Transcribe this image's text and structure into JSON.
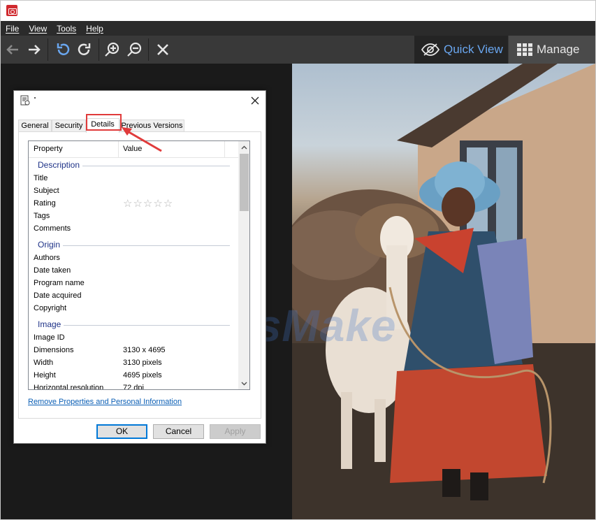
{
  "menubar": {
    "items": [
      "File",
      "View",
      "Tools",
      "Help"
    ]
  },
  "toolbar": {
    "icons": [
      "back-arrow",
      "forward-arrow",
      "rotate-left",
      "rotate-right",
      "zoom-in",
      "zoom-out",
      "close"
    ],
    "quick_view_label": "Quick View",
    "manage_label": "Manage",
    "colors": {
      "quick_view": "#6aa7f0",
      "toolbar_bg": "#393939",
      "menubar_bg": "#2b2b2b"
    }
  },
  "watermark": "TipsMake",
  "dialog": {
    "tabs": [
      "General",
      "Security",
      "Details",
      "Previous Versions"
    ],
    "active_tab": "Details",
    "highlight_color": "#e03b3b",
    "columns": {
      "property": "Property",
      "value": "Value"
    },
    "groups": {
      "description": "Description",
      "origin": "Origin",
      "image": "Image"
    },
    "rows": {
      "title": {
        "p": "Title",
        "v": ""
      },
      "subject": {
        "p": "Subject",
        "v": ""
      },
      "rating": {
        "p": "Rating",
        "v": "☆☆☆☆☆"
      },
      "tags": {
        "p": "Tags",
        "v": ""
      },
      "comments": {
        "p": "Comments",
        "v": ""
      },
      "authors": {
        "p": "Authors",
        "v": ""
      },
      "date_taken": {
        "p": "Date taken",
        "v": ""
      },
      "program_name": {
        "p": "Program name",
        "v": ""
      },
      "date_acquired": {
        "p": "Date acquired",
        "v": ""
      },
      "copyright": {
        "p": "Copyright",
        "v": ""
      },
      "image_id": {
        "p": "Image ID",
        "v": ""
      },
      "dimensions": {
        "p": "Dimensions",
        "v": "3130 x 4695"
      },
      "width": {
        "p": "Width",
        "v": "3130 pixels"
      },
      "height": {
        "p": "Height",
        "v": "4695 pixels"
      },
      "horizontal_resolution": {
        "p": "Horizontal resolution",
        "v": "72 dpi"
      }
    },
    "remove_link": "Remove Properties and Personal Information",
    "buttons": {
      "ok": "OK",
      "cancel": "Cancel",
      "apply": "Apply"
    }
  }
}
